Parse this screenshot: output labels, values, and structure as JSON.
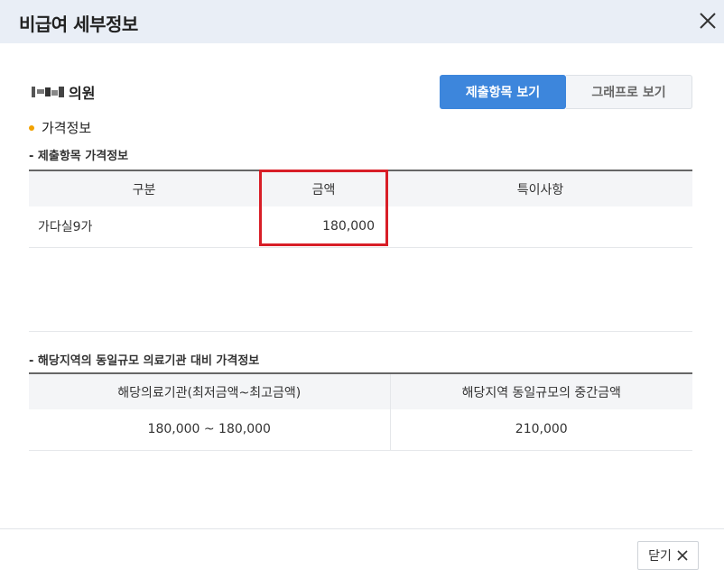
{
  "dialog": {
    "title": "비급여 세부정보"
  },
  "clinic": {
    "name": "의원"
  },
  "tabs": {
    "submit_label": "제출항목 보기",
    "graph_label": "그래프로 보기"
  },
  "section": {
    "title": "가격정보"
  },
  "submitted": {
    "subtitle": "- 제출항목 가격정보",
    "headers": [
      "구분",
      "금액",
      "특이사항"
    ],
    "rows": [
      {
        "category": "가다실9가",
        "amount": "180,000",
        "note": ""
      }
    ]
  },
  "regional": {
    "subtitle": "- 해당지역의 동일규모 의료기관 대비 가격정보",
    "headers": [
      "해당의료기관(최저금액~최고금액)",
      "해당지역 동일규모의 중간금액"
    ],
    "rows": [
      {
        "range": "180,000 ~ 180,000",
        "median": "210,000"
      }
    ]
  },
  "footer": {
    "close_label": "닫기"
  },
  "colors": {
    "primary": "#3d86dc",
    "highlight": "#d81e27",
    "dot": "#f2a200",
    "header_bg": "#e9eef6"
  },
  "icons": {
    "close": "close-icon",
    "bullet": "bullet-dot-icon"
  }
}
